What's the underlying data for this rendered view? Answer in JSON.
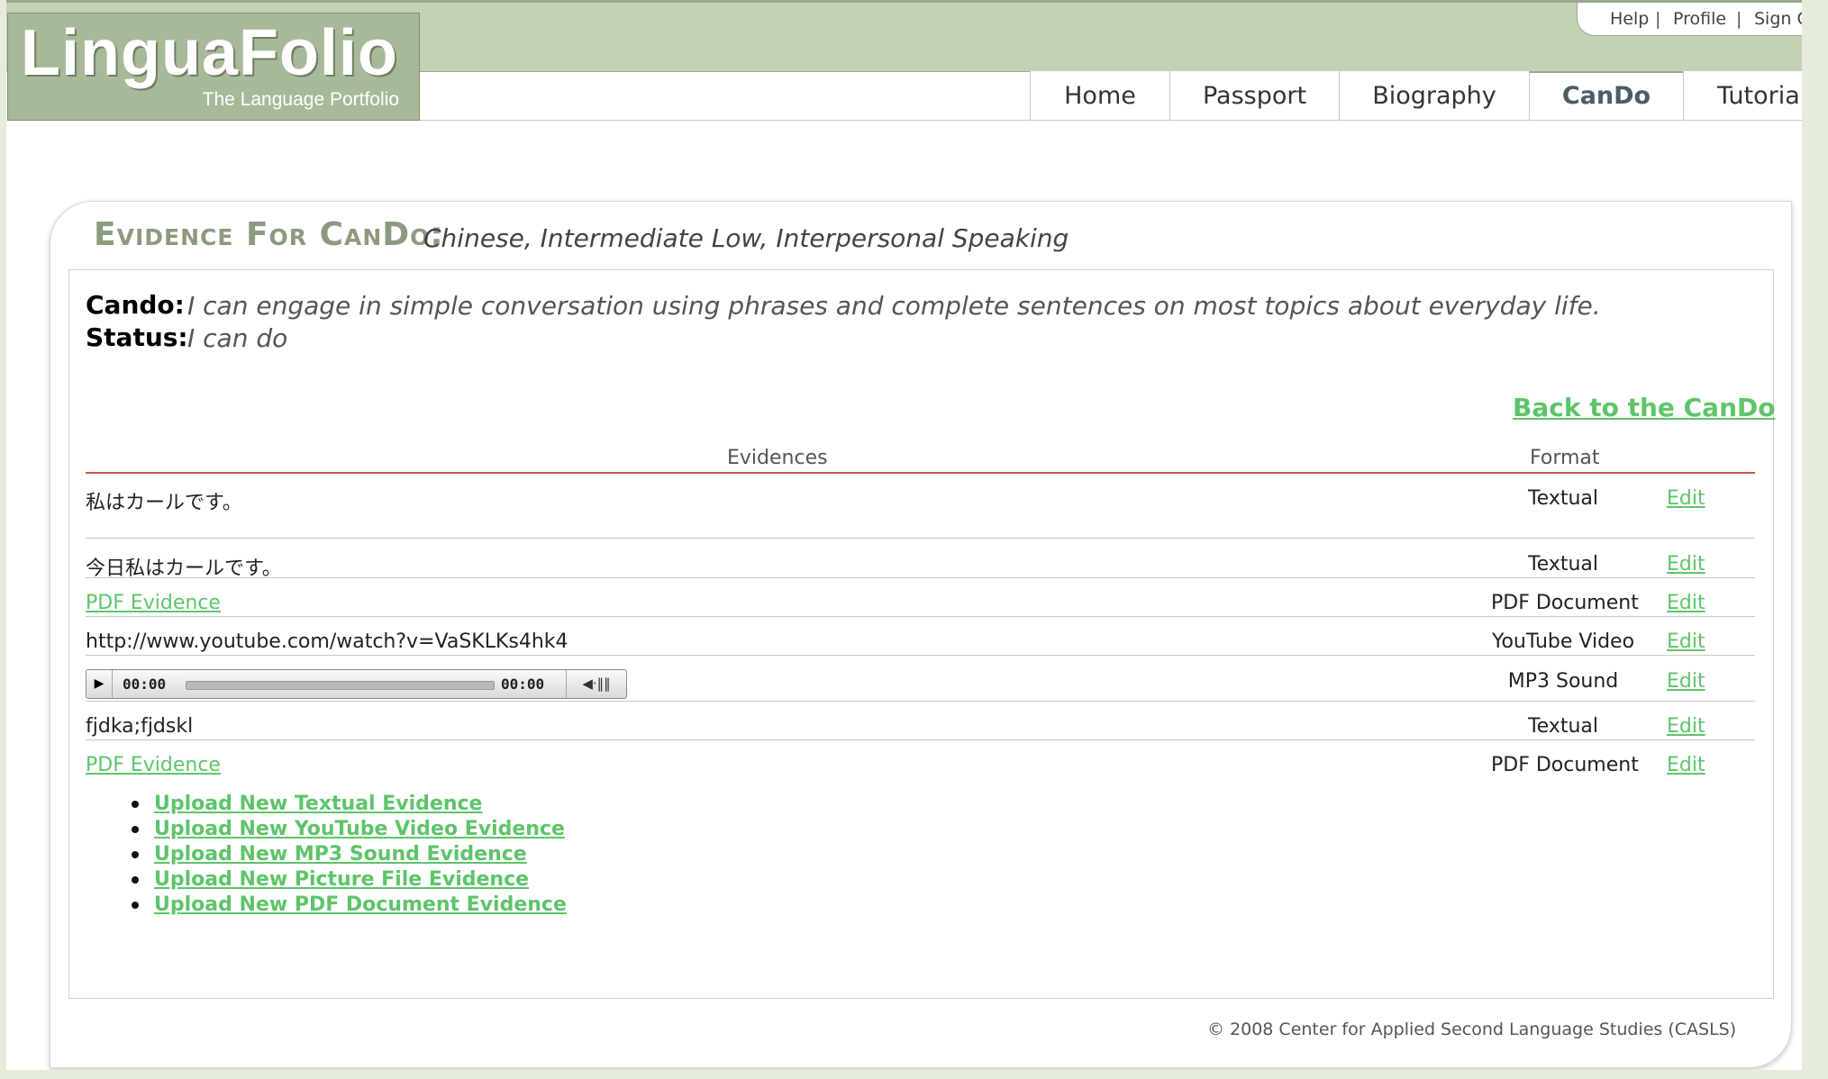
{
  "app": {
    "logo_title": "LinguaFolio",
    "logo_subtitle": "The Language Portfolio"
  },
  "utility_nav": {
    "items": [
      {
        "label": "Help"
      },
      {
        "label": "Profile"
      },
      {
        "label": "Sign Out"
      }
    ]
  },
  "tabs": [
    {
      "label": "Home",
      "active": false
    },
    {
      "label": "Passport",
      "active": false
    },
    {
      "label": "Biography",
      "active": false
    },
    {
      "label": "CanDo",
      "active": true
    },
    {
      "label": "Tutorial",
      "active": false
    }
  ],
  "panel": {
    "title": "Evidence For CanDo:",
    "subtitle": "Chinese, Intermediate Low, Interpersonal Speaking",
    "cando_label": "Cando:",
    "cando_value": "I can engage in simple conversation using phrases and complete sentences on most topics about everyday life.",
    "status_label": "Status:",
    "status_value": "I can do",
    "back_link": "Back to the CanDo"
  },
  "evidence_table": {
    "columns": [
      "Evidences",
      "Format"
    ],
    "rows": [
      {
        "evidence": "私はカールです。",
        "kind": "text",
        "format": "Textual",
        "action": "Edit"
      },
      {
        "evidence": "今日私はカールです。",
        "kind": "text",
        "format": "Textual",
        "action": "Edit"
      },
      {
        "evidence": "PDF Evidence",
        "kind": "link",
        "format": "PDF Document",
        "action": "Edit"
      },
      {
        "evidence": "http://www.youtube.com/watch?v=VaSKLKs4hk4",
        "kind": "text",
        "format": "YouTube Video",
        "action": "Edit"
      },
      {
        "evidence": "",
        "kind": "player",
        "format": "MP3 Sound",
        "action": "Edit"
      },
      {
        "evidence": "fjdka;fjdskl",
        "kind": "text",
        "format": "Textual",
        "action": "Edit"
      },
      {
        "evidence": "PDF Evidence",
        "kind": "link",
        "format": "PDF Document",
        "action": "Edit"
      }
    ]
  },
  "audio_player": {
    "play_icon": "play-icon",
    "elapsed": "00:00",
    "duration": "00:00",
    "volume_icon": "volume-icon",
    "progress": 0
  },
  "upload_links": [
    "Upload New Textual Evidence",
    "Upload New YouTube Video Evidence",
    "Upload New MP3 Sound Evidence",
    "Upload New Picture File Evidence",
    "Upload New PDF Document Evidence"
  ],
  "footer": {
    "copyright": "© 2008 Center for Applied Second Language Studies (CASLS)"
  },
  "colors": {
    "header_green": "#c3d2b5",
    "logo_green": "#a8b99a",
    "link_green": "#5ec46a",
    "title_green": "#8c9a80",
    "table_rule_red": "#c8594f"
  }
}
